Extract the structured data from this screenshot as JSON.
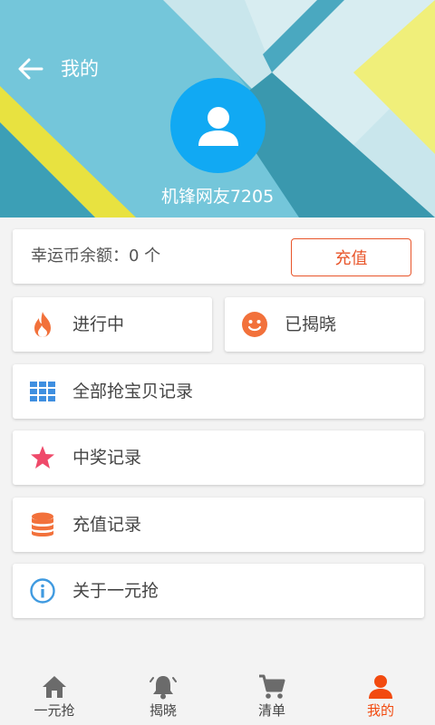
{
  "header": {
    "title": "我的",
    "username": "机锋网友7205",
    "back_icon": "arrow-left-icon",
    "avatar_icon": "user-avatar-icon"
  },
  "balance": {
    "text": "幸运币余额：0 个",
    "recharge_label": "充值"
  },
  "status_tabs": [
    {
      "label": "进行中",
      "icon": "flame-icon",
      "color": "#f2713b"
    },
    {
      "label": "已揭晓",
      "icon": "smile-icon",
      "color": "#f2713b"
    }
  ],
  "menu": [
    {
      "label": "全部抢宝贝记录",
      "icon": "grid-icon",
      "color": "#3f8fe0"
    },
    {
      "label": "中奖记录",
      "icon": "star-icon",
      "color": "#ef4a6a"
    },
    {
      "label": "充值记录",
      "icon": "coins-icon",
      "color": "#f2713b"
    },
    {
      "label": "关于一元抢",
      "icon": "info-icon",
      "color": "#3f9ae0"
    }
  ],
  "bottom_nav": [
    {
      "label": "一元抢",
      "icon": "home-icon",
      "active": false
    },
    {
      "label": "揭晓",
      "icon": "bell-icon",
      "active": false
    },
    {
      "label": "清单",
      "icon": "cart-icon",
      "active": false
    },
    {
      "label": "我的",
      "icon": "person-icon",
      "active": true
    }
  ],
  "colors": {
    "accent": "#f24a0f",
    "avatar_bg": "#11a9f3",
    "nav_inactive": "#6b6b6b"
  }
}
